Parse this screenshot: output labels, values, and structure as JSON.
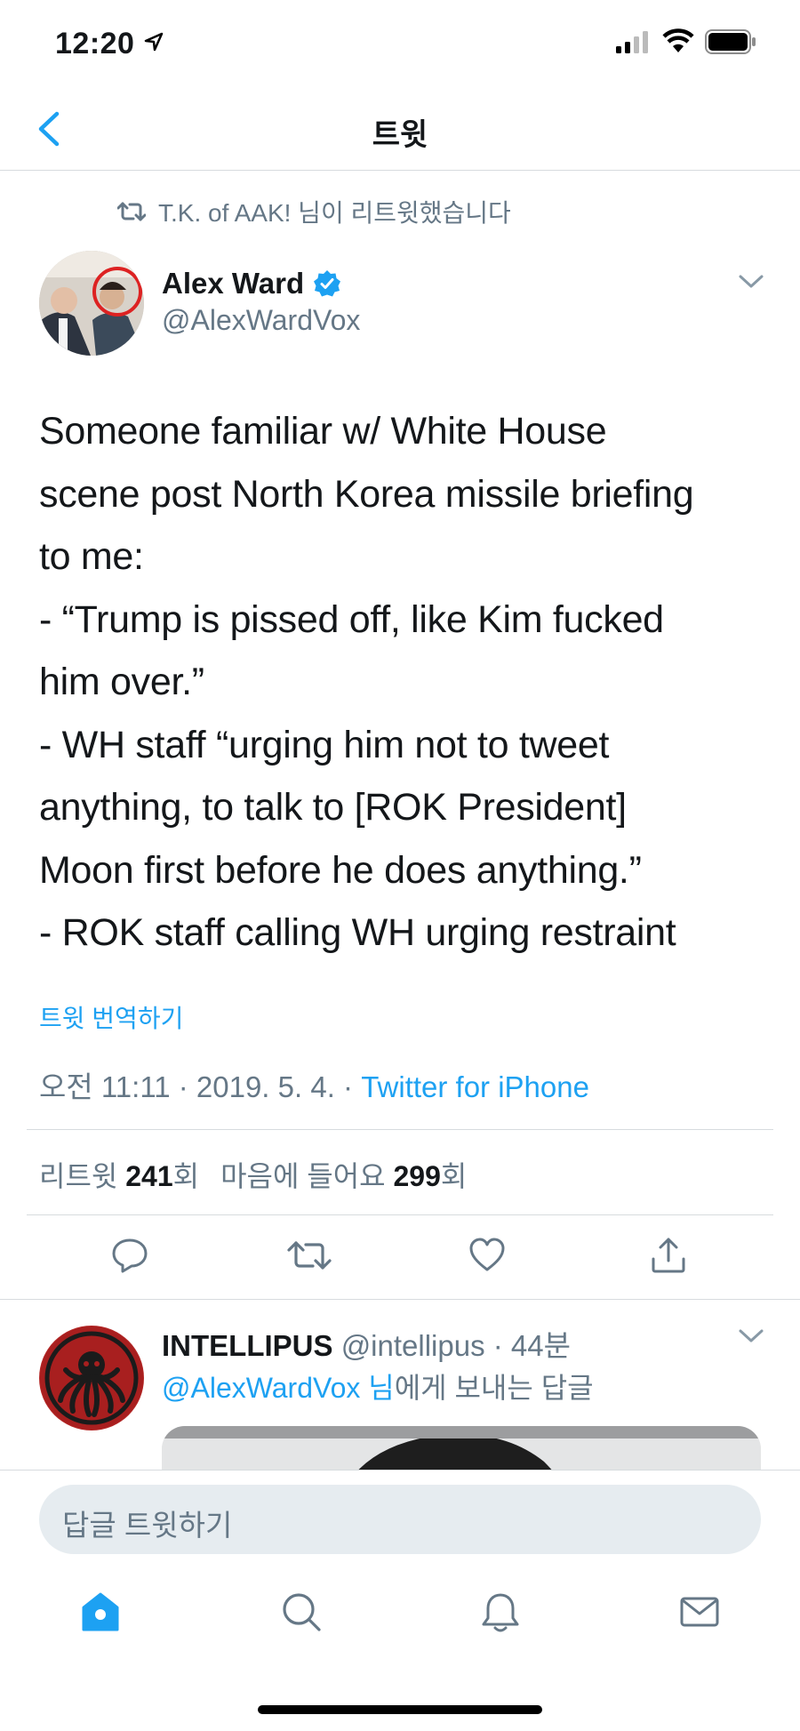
{
  "status_bar": {
    "time": "12:20"
  },
  "nav": {
    "title": "트윗"
  },
  "retweet_context": "T.K. of AAK! 님이 리트윗했습니다",
  "tweet": {
    "author_name": "Alex Ward",
    "handle": "@AlexWardVox",
    "lines": [
      "Someone familiar w/ White House",
      "scene post North Korea missile briefing",
      "to me:",
      "- “Trump is pissed off, like Kim fucked",
      "him over.”",
      "- WH staff “urging him not to tweet",
      "anything, to talk to [ROK President]",
      "Moon first before he does anything.”",
      "- ROK staff calling WH urging restraint"
    ],
    "translate_label": "트윗 번역하기",
    "timestamp": "오전 11:11 · 2019. 5. 4. · ",
    "source": "Twitter for iPhone",
    "stats": {
      "retweet_label": "리트윗 ",
      "retweet_count": "241",
      "retweet_suffix": "회",
      "like_label": "마음에 들어요 ",
      "like_count": "299",
      "like_suffix": "회"
    }
  },
  "reply": {
    "author_name": "INTELLIPUS",
    "handle": "@intellipus",
    "age": "· 44분",
    "mention": "@AlexWardVox 님",
    "reply_suffix": "에게 보내는 답글"
  },
  "composer": {
    "placeholder": "답글 트윗하기"
  },
  "tabs": [
    "home",
    "search",
    "notifications",
    "messages"
  ],
  "colors": {
    "accent": "#1da1f2",
    "secondary_text": "#657786",
    "divider": "#d7dbde"
  }
}
